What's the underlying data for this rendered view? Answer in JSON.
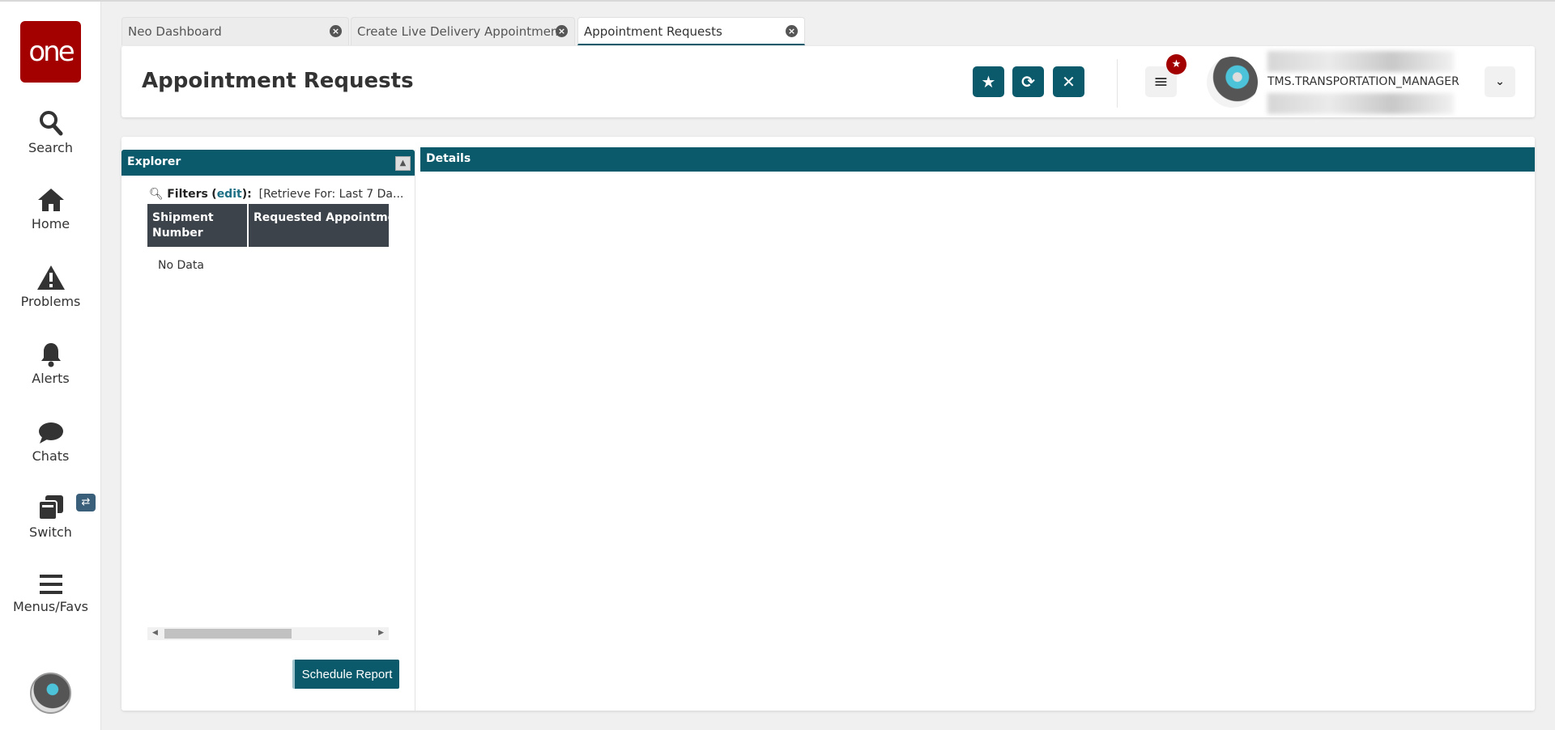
{
  "sidebar": {
    "logo": "one",
    "items": [
      {
        "label": "Search"
      },
      {
        "label": "Home"
      },
      {
        "label": "Problems"
      },
      {
        "label": "Alerts"
      },
      {
        "label": "Chats"
      },
      {
        "label": "Switch"
      },
      {
        "label": "Menus/Favs"
      }
    ],
    "switch_badge": "⇄"
  },
  "tabs": [
    {
      "label": "Neo Dashboard"
    },
    {
      "label": "Create Live Delivery Appointment"
    },
    {
      "label": "Appointment Requests",
      "active": true
    }
  ],
  "header": {
    "title": "Appointment Requests",
    "username": "TMS.TRANSPORTATION_MANAGER"
  },
  "explorer": {
    "title": "Explorer",
    "filters_label": "Filters",
    "edit_label": "edit",
    "filter_value": "[Retrieve For: Last 7 Da...",
    "columns": [
      "Shipment Number",
      "Requested Appointment Date"
    ],
    "empty": "No Data",
    "schedule_report": "Schedule Report"
  },
  "details": {
    "title": "Details"
  },
  "colors": {
    "accent": "#0b5a6b",
    "brand": "#a30000",
    "grid_header": "#3d434b"
  }
}
